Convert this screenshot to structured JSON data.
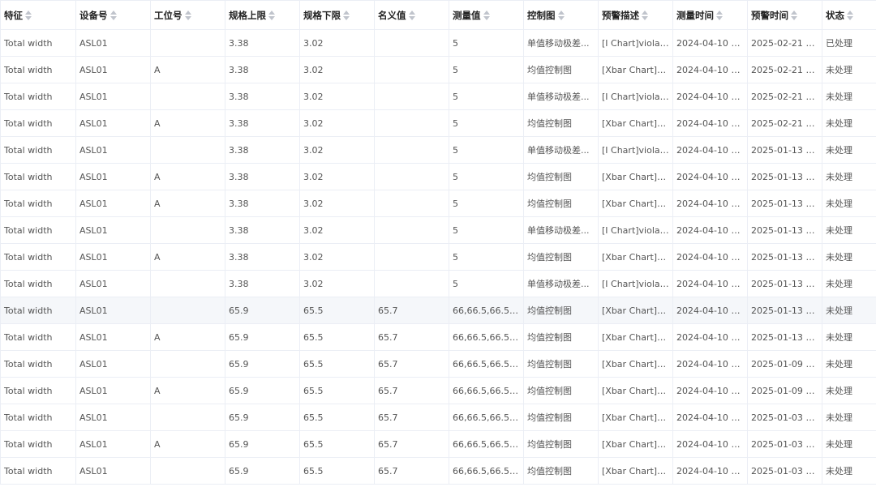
{
  "table": {
    "headers": [
      "特征",
      "设备号",
      "工位号",
      "规格上限",
      "规格下限",
      "名义值",
      "测量值",
      "控制图",
      "预警描述",
      "测量时间",
      "预警时间",
      "状态"
    ],
    "rows": [
      [
        "Total width",
        "ASL01",
        "",
        "3.38",
        "3.02",
        "",
        "5",
        "单值移动极差...",
        "[I Chart]violatio...",
        "2024-04-10 14:...",
        "2025-02-21 17:...",
        "已处理"
      ],
      [
        "Total width",
        "ASL01",
        "A",
        "3.38",
        "3.02",
        "",
        "5",
        "均值控制图",
        "[Xbar Chart]viol...",
        "2024-04-10 14:...",
        "2025-02-21 17:...",
        "未处理"
      ],
      [
        "Total width",
        "ASL01",
        "",
        "3.38",
        "3.02",
        "",
        "5",
        "单值移动极差...",
        "[I Chart]violatio...",
        "2024-04-10 14:...",
        "2025-02-21 10:...",
        "未处理"
      ],
      [
        "Total width",
        "ASL01",
        "A",
        "3.38",
        "3.02",
        "",
        "5",
        "均值控制图",
        "[Xbar Chart]viol...",
        "2024-04-10 14:...",
        "2025-02-21 10:...",
        "未处理"
      ],
      [
        "Total width",
        "ASL01",
        "",
        "3.38",
        "3.02",
        "",
        "5",
        "单值移动极差...",
        "[I Chart]violatio...",
        "2024-04-10 14:...",
        "2025-01-13 22:...",
        "未处理"
      ],
      [
        "Total width",
        "ASL01",
        "A",
        "3.38",
        "3.02",
        "",
        "5",
        "均值控制图",
        "[Xbar Chart]viol...",
        "2024-04-10 14:...",
        "2025-01-13 22:...",
        "未处理"
      ],
      [
        "Total width",
        "ASL01",
        "A",
        "3.38",
        "3.02",
        "",
        "5",
        "均值控制图",
        "[Xbar Chart]viol...",
        "2024-04-10 14:...",
        "2025-01-13 22:...",
        "未处理"
      ],
      [
        "Total width",
        "ASL01",
        "",
        "3.38",
        "3.02",
        "",
        "5",
        "单值移动极差...",
        "[I Chart]violatio...",
        "2024-04-10 14:...",
        "2025-01-13 22:...",
        "未处理"
      ],
      [
        "Total width",
        "ASL01",
        "A",
        "3.38",
        "3.02",
        "",
        "5",
        "均值控制图",
        "[Xbar Chart]viol...",
        "2024-04-10 14:...",
        "2025-01-13 22:...",
        "未处理"
      ],
      [
        "Total width",
        "ASL01",
        "",
        "3.38",
        "3.02",
        "",
        "5",
        "单值移动极差...",
        "[I Chart]violatio...",
        "2024-04-10 14:...",
        "2025-01-13 22:...",
        "未处理"
      ],
      [
        "Total width",
        "ASL01",
        "",
        "65.9",
        "65.5",
        "65.7",
        "66,66.5,66.5,66,...",
        "均值控制图",
        "[Xbar Chart]viol...",
        "2024-04-10 14:...",
        "2025-01-13 18:...",
        "未处理"
      ],
      [
        "Total width",
        "ASL01",
        "A",
        "65.9",
        "65.5",
        "65.7",
        "66,66.5,66.5,66,...",
        "均值控制图",
        "[Xbar Chart]viol...",
        "2024-04-10 14:...",
        "2025-01-13 18:...",
        "未处理"
      ],
      [
        "Total width",
        "ASL01",
        "",
        "65.9",
        "65.5",
        "65.7",
        "66,66.5,66.5,66,...",
        "均值控制图",
        "[Xbar Chart]viol...",
        "2024-04-10 14:...",
        "2025-01-09 20:...",
        "未处理"
      ],
      [
        "Total width",
        "ASL01",
        "A",
        "65.9",
        "65.5",
        "65.7",
        "66,66.5,66.5,66,...",
        "均值控制图",
        "[Xbar Chart]viol...",
        "2024-04-10 14:...",
        "2025-01-09 20:...",
        "未处理"
      ],
      [
        "Total width",
        "ASL01",
        "",
        "65.9",
        "65.5",
        "65.7",
        "66,66.5,66.5,66,...",
        "均值控制图",
        "[Xbar Chart]viol...",
        "2024-04-10 14:...",
        "2025-01-03 09:...",
        "未处理"
      ],
      [
        "Total width",
        "ASL01",
        "A",
        "65.9",
        "65.5",
        "65.7",
        "66,66.5,66.5,66,...",
        "均值控制图",
        "[Xbar Chart]viol...",
        "2024-04-10 14:...",
        "2025-01-03 09:...",
        "未处理"
      ],
      [
        "Total width",
        "ASL01",
        "",
        "65.9",
        "65.5",
        "65.7",
        "66,66.5,66.5,66,...",
        "均值控制图",
        "[Xbar Chart]viol...",
        "2024-04-10 14:...",
        "2025-01-03 09:...",
        "未处理"
      ]
    ]
  },
  "icons": {
    "sort": "sort-caret-icon"
  },
  "colors": {
    "border": "#ebeef5",
    "header_text": "#222222",
    "cell_text": "#555555",
    "hover_row": "#f5f7fa"
  }
}
